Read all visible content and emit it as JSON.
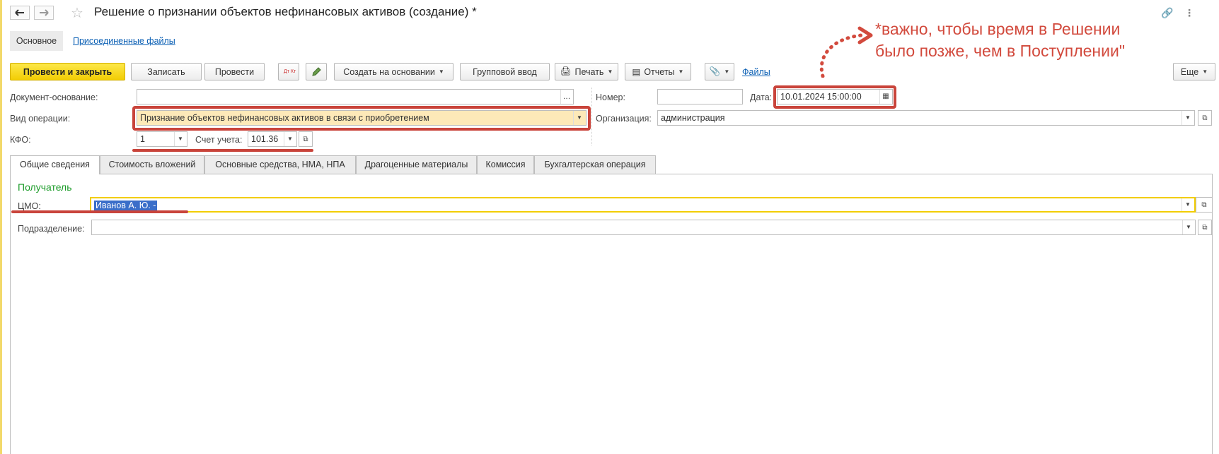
{
  "window": {
    "title": "Решение о признании объектов нефинансовых активов (создание) *"
  },
  "icons": {
    "back": "arrow-left-icon",
    "forward": "arrow-right-icon",
    "favorite": "star-icon",
    "link": "link-icon",
    "more": "more-vertical-icon",
    "dtkt": "dt-kt-icon",
    "attach": "paperclip-icon",
    "printer": "printer-icon",
    "reports": "report-icon"
  },
  "subnav": {
    "main": "Основное",
    "files": "Присоединенные файлы"
  },
  "toolbar": {
    "post_close": "Провести и закрыть",
    "save": "Записать",
    "post": "Провести",
    "dtkt": "Дт Кт",
    "create_based": "Создать на основании",
    "group_input": "Групповой ввод",
    "print": "Печать",
    "reports": "Отчеты",
    "files": "Файлы",
    "more": "Еще"
  },
  "form": {
    "doc_base_label": "Документ-основание:",
    "doc_base_value": "",
    "operation_label": "Вид операции:",
    "operation_value": "Признание объектов нефинансовых активов в связи с приобретением",
    "kfo_label": "КФО:",
    "kfo_value": "1",
    "account_label": "Счет учета:",
    "account_value": "101.36",
    "number_label": "Номер:",
    "number_value": "",
    "date_label": "Дата:",
    "date_value": "10.01.2024 15:00:00",
    "org_label": "Организация:",
    "org_value": "администрация"
  },
  "tabs": [
    {
      "label": "Общие сведения"
    },
    {
      "label": "Стоимость вложений"
    },
    {
      "label": "Основные средства, НМА, НПА"
    },
    {
      "label": "Драгоценные материалы"
    },
    {
      "label": "Комиссия"
    },
    {
      "label": "Бухгалтерская операция"
    }
  ],
  "recipient": {
    "section_title": "Получатель",
    "cmo_label": "ЦМО:",
    "cmo_value": "Иванов А. Ю. -",
    "dept_label": "Подразделение:",
    "dept_value": ""
  },
  "annotation": {
    "line1": "*важно, чтобы время в Решении",
    "line2": "было позже, чем в Поступлении\""
  },
  "colors": {
    "accent_yellow": "#f2cd04",
    "highlight_red": "#c9443b",
    "section_green": "#1d9c2a",
    "link_blue": "#0a5fb4"
  }
}
